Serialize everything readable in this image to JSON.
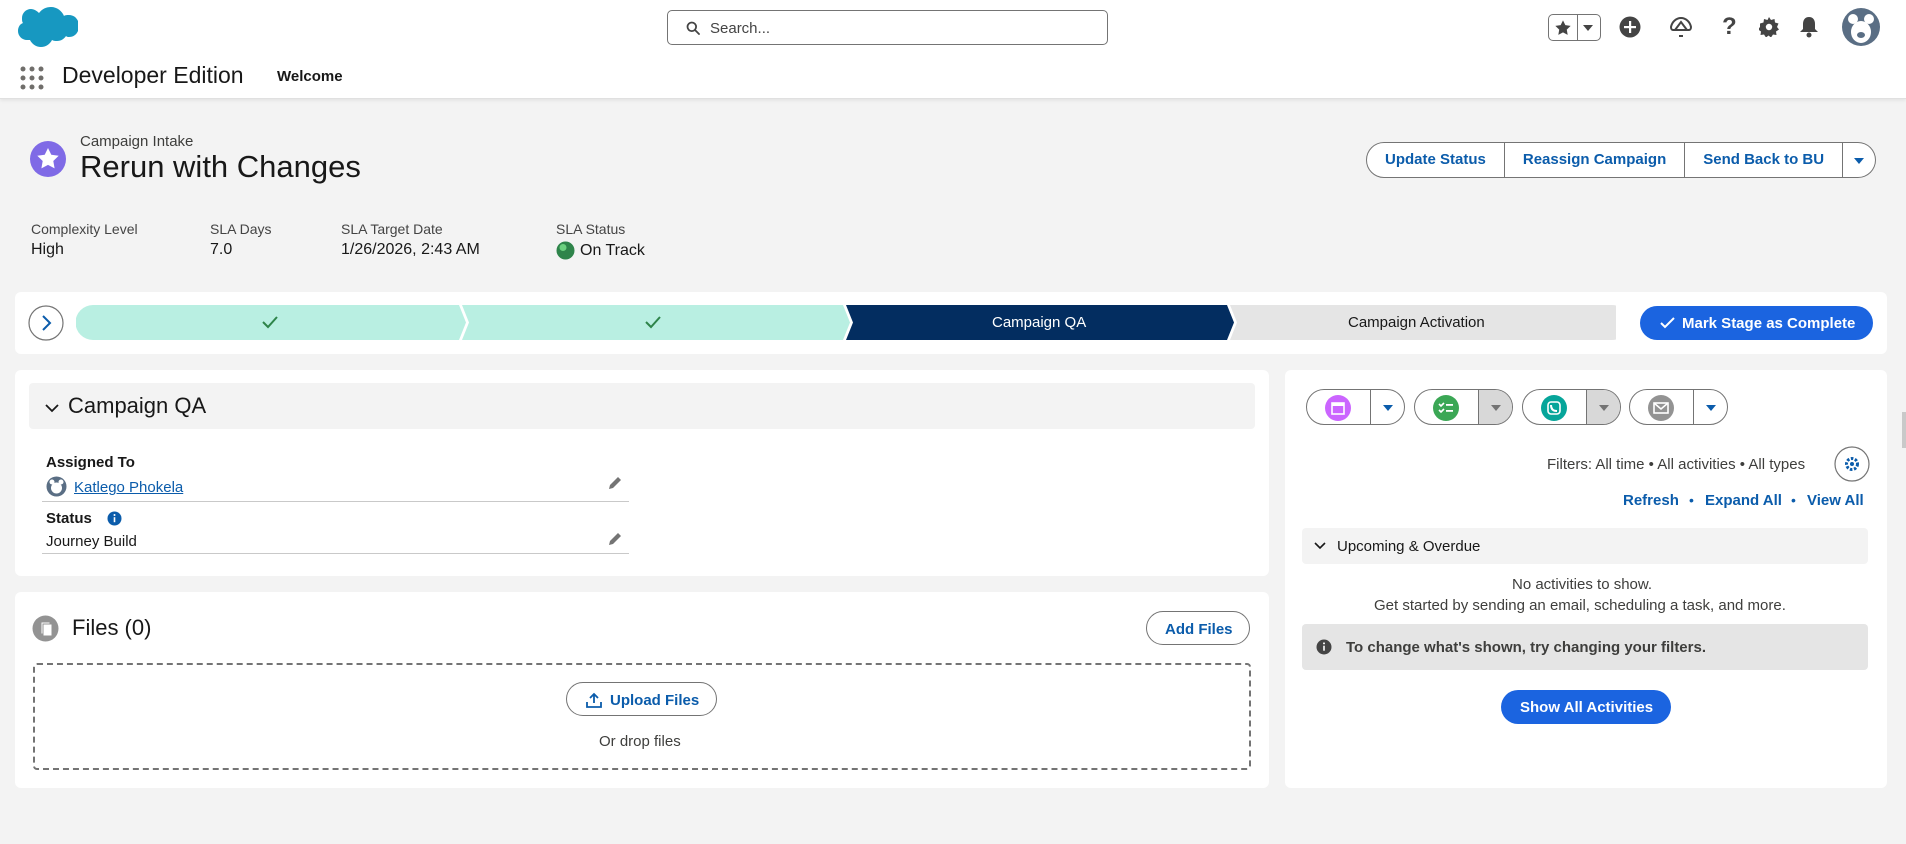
{
  "header": {
    "search_placeholder": "Search...",
    "app_name": "Developer Edition",
    "nav_tab": "Welcome"
  },
  "record": {
    "object_type": "Campaign Intake",
    "title": "Rerun with Changes",
    "actions": [
      "Update Status",
      "Reassign Campaign",
      "Send Back to BU"
    ],
    "fields": [
      {
        "label": "Complexity Level",
        "value": "High"
      },
      {
        "label": "SLA Days",
        "value": "7.0"
      },
      {
        "label": "SLA Target Date",
        "value": "1/26/2026, 2:43 AM"
      },
      {
        "label": "SLA Status",
        "value": "On Track"
      }
    ]
  },
  "path": {
    "stages": [
      {
        "label": "",
        "state": "complete"
      },
      {
        "label": "",
        "state": "complete"
      },
      {
        "label": "Campaign QA",
        "state": "current"
      },
      {
        "label": "Campaign Activation",
        "state": "incomplete"
      }
    ],
    "mark_complete_label": "Mark Stage as Complete"
  },
  "details": {
    "section_title": "Campaign QA",
    "assigned_to_label": "Assigned To",
    "assigned_to_value": "Katlego Phokela",
    "status_label": "Status",
    "status_value": "Journey Build"
  },
  "files": {
    "title": "Files (0)",
    "add_label": "Add Files",
    "upload_label": "Upload Files",
    "drop_label": "Or drop files"
  },
  "activity": {
    "filters_text": "Filters: All time • All activities • All types",
    "refresh_label": "Refresh",
    "expand_label": "Expand All",
    "view_all_label": "View All",
    "sep": "•",
    "upcoming_label": "Upcoming & Overdue",
    "empty_title": "No activities to show.",
    "empty_sub": "Get started by sending an email, scheduling a task, and more.",
    "notice": "To change what's shown, try changing your filters.",
    "show_all_label": "Show All Activities"
  },
  "colors": {
    "brand": "#1b64e0",
    "path_complete": "#b9efe2",
    "path_current": "#032d60",
    "path_incomplete": "#e5e5e5",
    "status_green": "#2e844a"
  }
}
